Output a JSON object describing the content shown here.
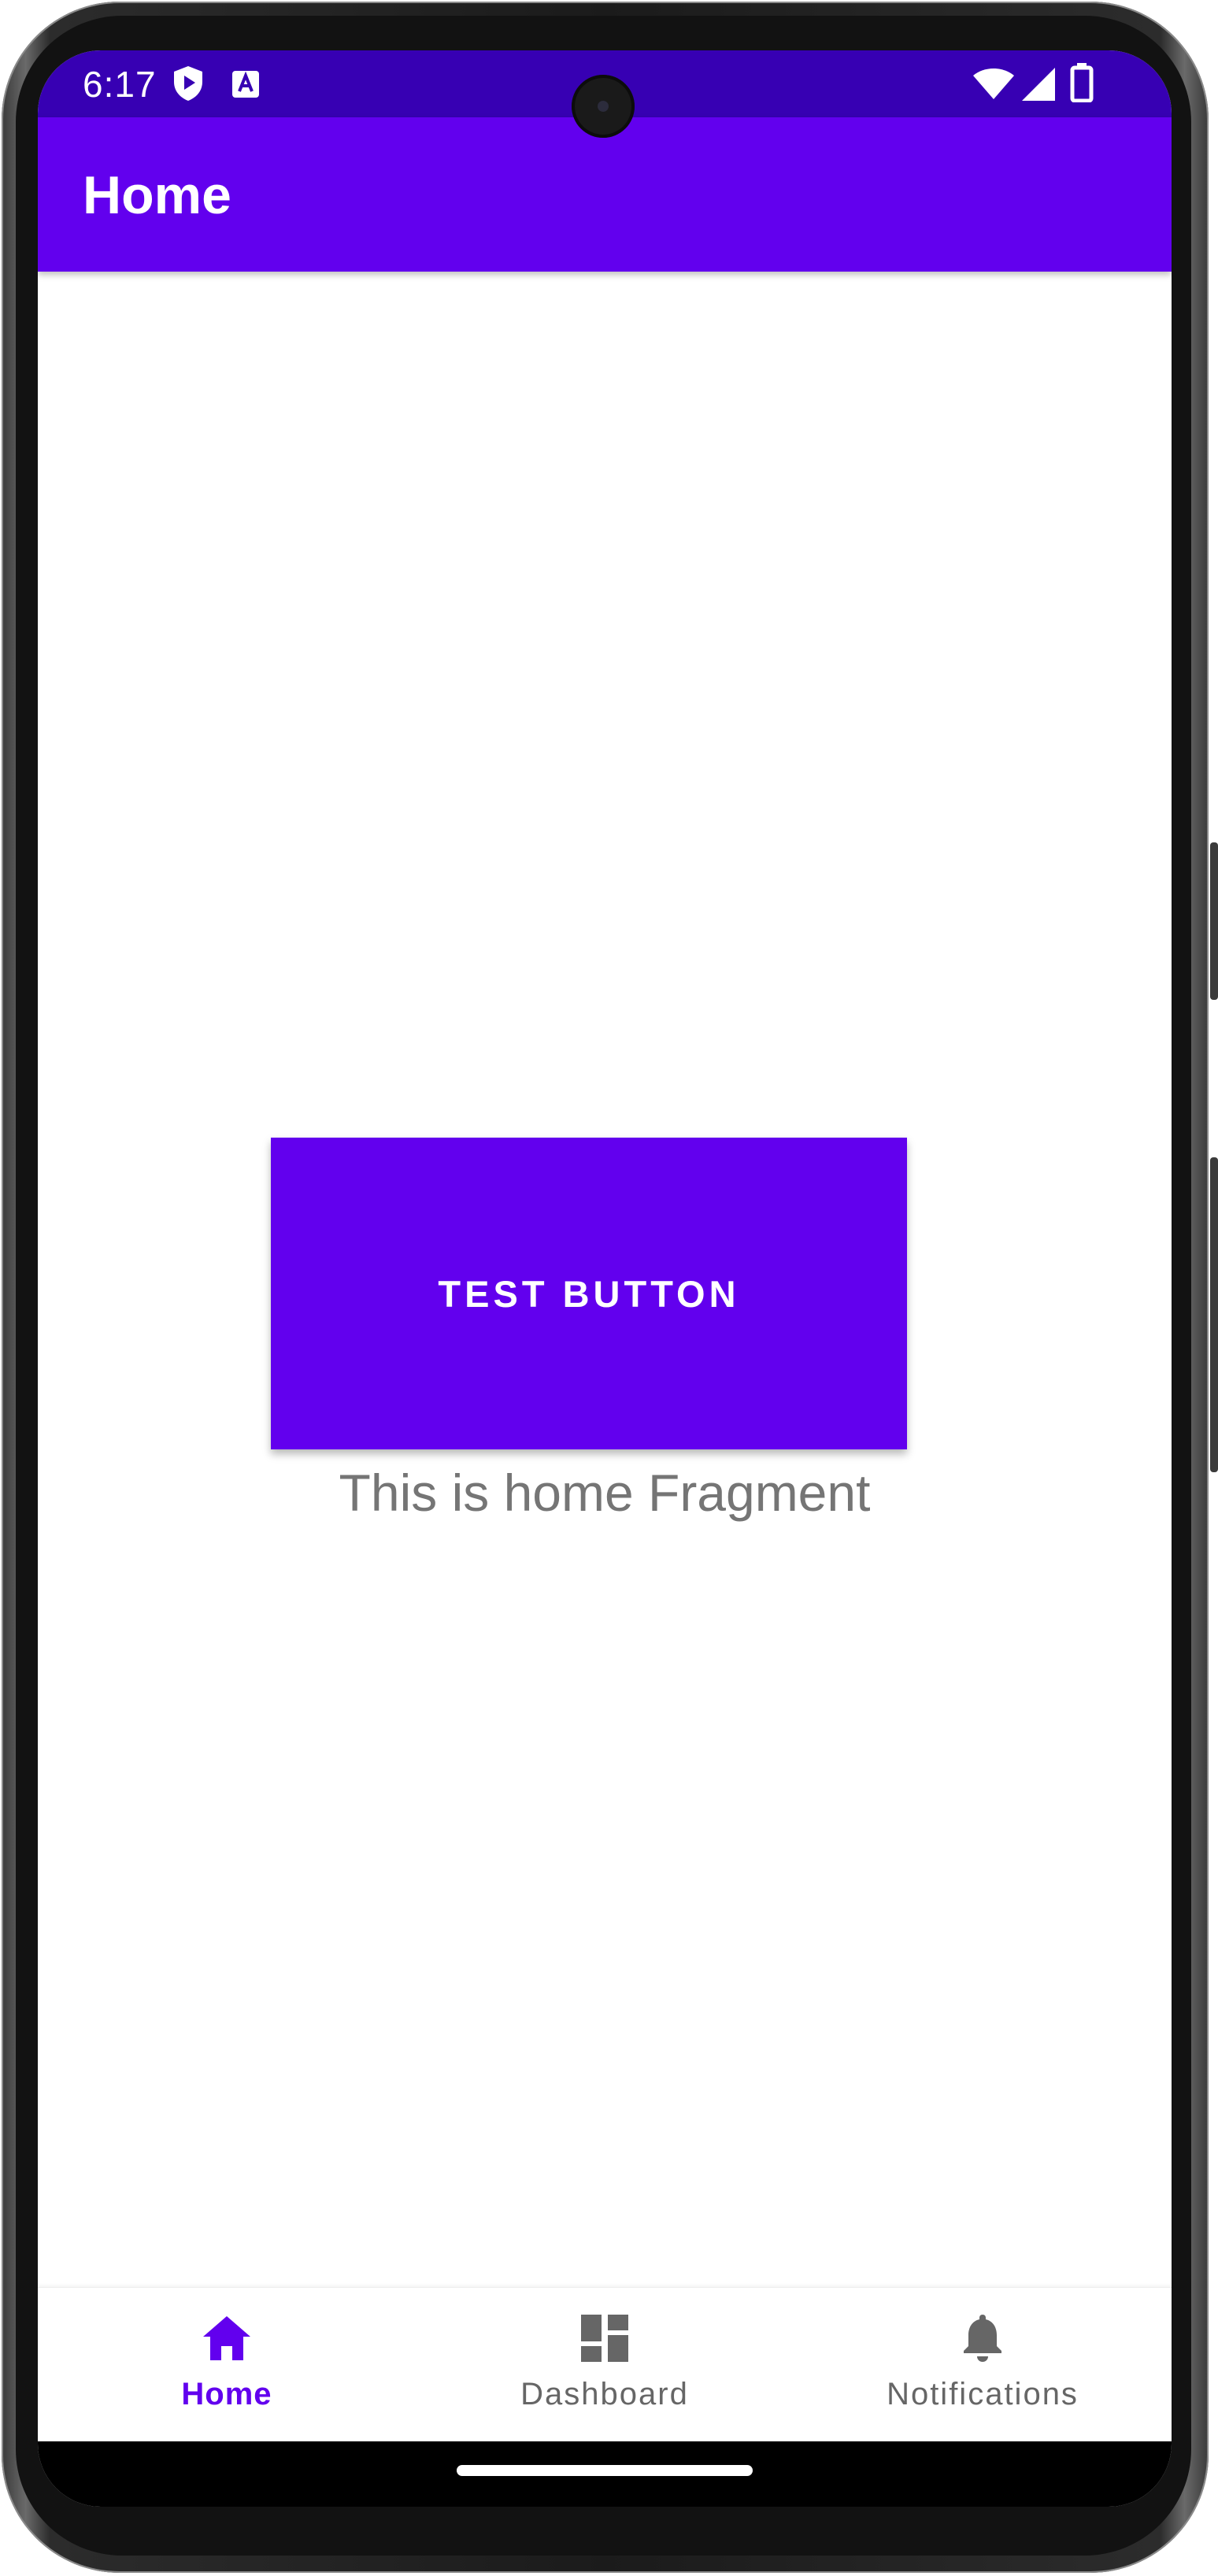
{
  "status_bar": {
    "time": "6:17",
    "left_icons": [
      "play-protect-icon",
      "keyboard-a-icon"
    ],
    "right_icons": [
      "wifi-icon",
      "cellular-signal-icon",
      "battery-icon"
    ],
    "background": "#3700b3"
  },
  "app_bar": {
    "title": "Home",
    "background": "#6200ee"
  },
  "content": {
    "text": "This is home Fragment",
    "button_label": "TEST BUTTON",
    "button_color": "#6200ee"
  },
  "bottom_nav": {
    "items": [
      {
        "label": "Home",
        "icon": "home-icon",
        "active": true
      },
      {
        "label": "Dashboard",
        "icon": "dashboard-icon",
        "active": false
      },
      {
        "label": "Notifications",
        "icon": "bell-icon",
        "active": false
      }
    ],
    "active_color": "#6200ee",
    "inactive_color": "#666666"
  }
}
